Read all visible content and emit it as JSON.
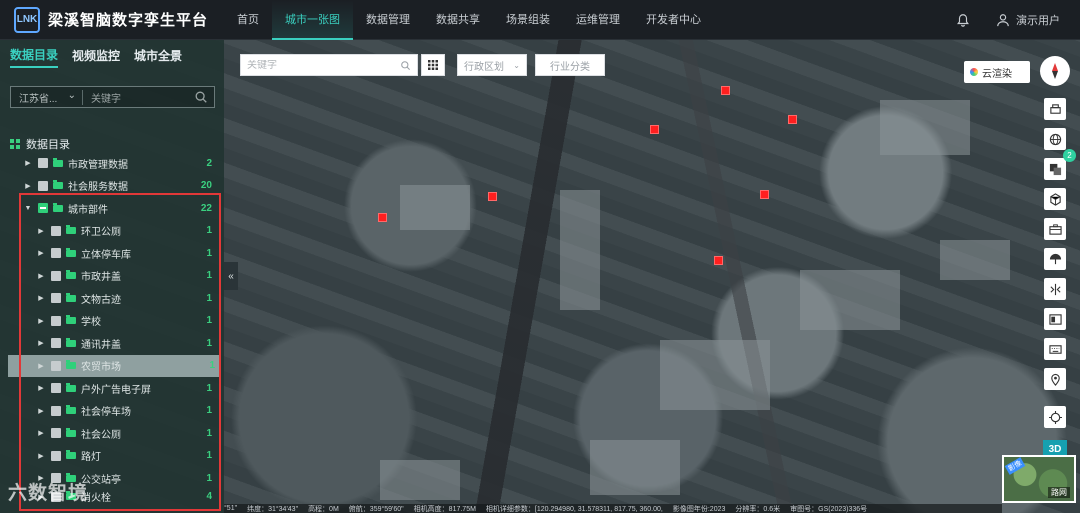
{
  "header": {
    "app_title": "梁溪智脑数字孪生平台",
    "logo_glyph": "LNK",
    "nav": [
      "首页",
      "城市一张图",
      "数据管理",
      "数据共享",
      "场景组装",
      "运维管理",
      "开发者中心"
    ],
    "active_nav": "城市一张图",
    "user_name": "演示用户"
  },
  "search": {
    "keyword_placeholder": "关键字",
    "district_select": "行政区划",
    "industry_select": "行业分类"
  },
  "panel": {
    "tabs": [
      "数据目录",
      "视频监控",
      "城市全景"
    ],
    "active_tab": "数据目录",
    "region_select": "江苏省...",
    "keyword_placeholder": "关键字",
    "section_title": "数据目录",
    "tree": [
      {
        "label": "市政管理数据",
        "count": "2",
        "level": 1,
        "expanded": false
      },
      {
        "label": "社会服务数据",
        "count": "20",
        "level": 1,
        "expanded": false
      },
      {
        "label": "城市部件",
        "count": "22",
        "level": 1,
        "expanded": true
      },
      {
        "label": "环卫公厕",
        "count": "1",
        "level": 2
      },
      {
        "label": "立体停车库",
        "count": "1",
        "level": 2
      },
      {
        "label": "市政井盖",
        "count": "1",
        "level": 2
      },
      {
        "label": "文物古迹",
        "count": "1",
        "level": 2
      },
      {
        "label": "学校",
        "count": "1",
        "level": 2
      },
      {
        "label": "通讯井盖",
        "count": "1",
        "level": 2
      },
      {
        "label": "农贸市场",
        "count": "1",
        "level": 2,
        "highlighted": true
      },
      {
        "label": "户外广告电子屏",
        "count": "1",
        "level": 2
      },
      {
        "label": "社会停车场",
        "count": "1",
        "level": 2
      },
      {
        "label": "社会公厕",
        "count": "1",
        "level": 2
      },
      {
        "label": "路灯",
        "count": "1",
        "level": 2
      },
      {
        "label": "公交站亭",
        "count": "1",
        "level": 2
      },
      {
        "label": "消火栓",
        "count": "4",
        "level": 2
      }
    ]
  },
  "map": {
    "cloud_button": "云渲染",
    "layer_badge": "2",
    "mode_button": "3D",
    "thumbnail_tag": "影像",
    "thumbnail_label": "路网"
  },
  "status_bar": {
    "items": [
      "°51\"",
      "纬度：31°34'43\"",
      "高程：0M",
      "俯航：359°59'60\"",
      "相机高度：817.75M",
      "相机详细参数：[120.294980, 31.578311, 817.75, 360.00,",
      "影像图年份:2023",
      "分辨率：0.6米",
      "审图号：GS(2023)336号"
    ]
  },
  "watermark": "六数智境",
  "colors": {
    "accent": "#3ad0c0",
    "count_green": "#3ad080",
    "marker_red": "#ff1f1f",
    "frame_red": "#e23838"
  }
}
